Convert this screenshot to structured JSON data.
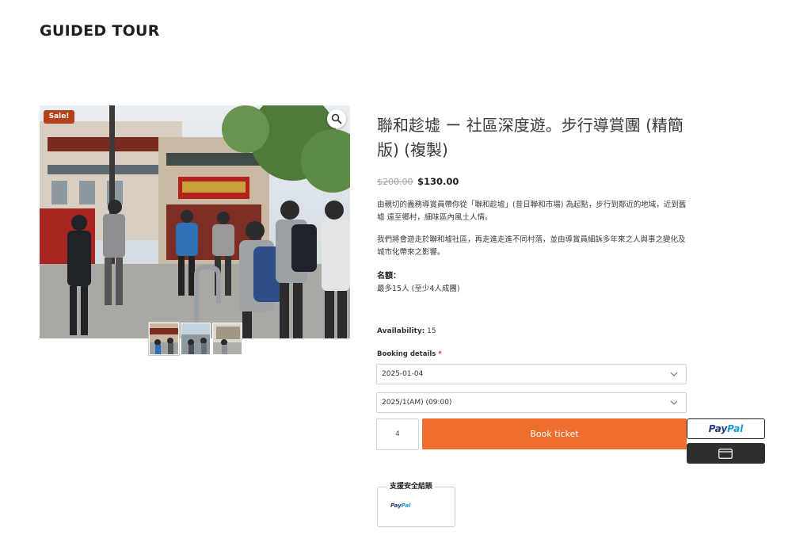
{
  "site": {
    "title": "GUIDED TOUR"
  },
  "gallery": {
    "sale_badge": "Sale!",
    "zoom_icon": "magnifier-icon",
    "thumbnails": [
      "thumb-1",
      "thumb-2",
      "thumb-3"
    ]
  },
  "product": {
    "title": "聯和趁墟 ー 社區深度遊。步行導賞團 (精簡版) (複製)",
    "price_old": "$200.00",
    "price_new": "$130.00",
    "description_1": "由親切的義務導賞員帶你從「聯和趁墟」(昔日聯和市場) 為起點，步行到鄰近的地域，近到舊墟 遠至鄉村，細味區內風土人情。",
    "description_2": "我們將會遊走於聯和墟社區，再走進走進不同村落，並由導賞員細訴多年來之人與事之變化及城市化帶來之影響。",
    "quota_label": "名額：",
    "quota_value": "最多15人 (至少4人成團)"
  },
  "booking": {
    "availability_label": "Availability:",
    "availability_value": "15",
    "details_label": "Booking details",
    "required_mark": "*",
    "date_value": "2025-01-04",
    "time_value": "2025/1(AM) (09:00)",
    "quantity": "4",
    "book_button": "Book ticket"
  },
  "payment": {
    "paypal_part1": "Pay",
    "paypal_part2": "Pal",
    "card_icon": "credit-card-icon",
    "secure_label": "支援安全結賬",
    "secure_paypal_part1": "Pay",
    "secure_paypal_part2": "Pal"
  },
  "colors": {
    "accent": "#ed6e2f",
    "sale": "#b5421b",
    "paypal_dark": "#253b80",
    "paypal_light": "#179bd7"
  }
}
